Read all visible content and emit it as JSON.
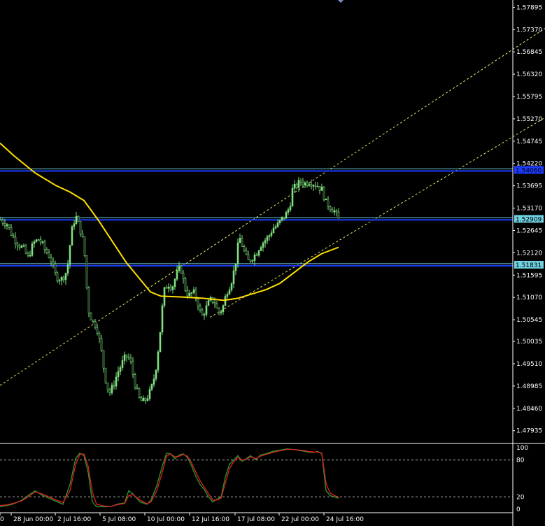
{
  "colors": {
    "background": "#000000",
    "axis": "#ffffff",
    "bull_candle": "#7fe07f",
    "bear_candle": "#7fe07f",
    "ma_line": "#ffe000",
    "channel": "#e8e86a",
    "hline_blue": "#1e3cff",
    "hline_cyan": "#6fd0e0",
    "stoch_main": "#2e9a2e",
    "stoch_signal": "#e02020",
    "stoch_level": "#bbbbbb"
  },
  "chart_data": [
    {
      "type": "candlestick",
      "panel": "price",
      "ylim": [
        1.477,
        1.58
      ],
      "y_ticks": [
        "1.57895",
        "1.57370",
        "1.56845",
        "1.56320",
        "1.55795",
        "1.55270",
        "1.54745",
        "1.54220",
        "1.53695",
        "1.53170",
        "1.52645",
        "1.52120",
        "1.51595",
        "1.51070",
        "1.50545",
        "1.50035",
        "1.49510",
        "1.48985",
        "1.48460",
        "1.47935"
      ],
      "x_ticks": [
        "0",
        "28 Jun 00:00",
        "2 Jul 16:00",
        "5 Jul 08:00",
        "10 Jul 00:00",
        "12 Jul 16:00",
        "17 Jul 08:00",
        "22 Jul 00:00",
        "24 Jul 16:00"
      ],
      "close_path": [
        [
          0,
          1.529
        ],
        [
          10,
          1.528
        ],
        [
          18,
          1.525
        ],
        [
          25,
          1.5235
        ],
        [
          34,
          1.522
        ],
        [
          40,
          1.52
        ],
        [
          48,
          1.5235
        ],
        [
          56,
          1.5245
        ],
        [
          64,
          1.522
        ],
        [
          72,
          1.52
        ],
        [
          80,
          1.5155
        ],
        [
          88,
          1.515
        ],
        [
          96,
          1.517
        ],
        [
          102,
          1.526
        ],
        [
          108,
          1.53
        ],
        [
          114,
          1.527
        ],
        [
          120,
          1.523
        ],
        [
          126,
          1.508
        ],
        [
          132,
          1.505
        ],
        [
          138,
          1.504
        ],
        [
          144,
          1.499
        ],
        [
          150,
          1.492
        ],
        [
          156,
          1.488
        ],
        [
          162,
          1.49
        ],
        [
          168,
          1.493
        ],
        [
          174,
          1.495
        ],
        [
          180,
          1.497
        ],
        [
          186,
          1.496
        ],
        [
          192,
          1.491
        ],
        [
          198,
          1.487
        ],
        [
          204,
          1.486
        ],
        [
          210,
          1.487
        ],
        [
          216,
          1.489
        ],
        [
          222,
          1.493
        ],
        [
          228,
          1.501
        ],
        [
          234,
          1.512
        ],
        [
          240,
          1.514
        ],
        [
          246,
          1.513
        ],
        [
          252,
          1.516
        ],
        [
          258,
          1.518
        ],
        [
          264,
          1.513
        ],
        [
          270,
          1.511
        ],
        [
          276,
          1.512
        ],
        [
          282,
          1.51
        ],
        [
          288,
          1.506
        ],
        [
          294,
          1.508
        ],
        [
          300,
          1.51
        ],
        [
          306,
          1.51
        ],
        [
          312,
          1.507
        ],
        [
          318,
          1.508
        ],
        [
          324,
          1.512
        ],
        [
          330,
          1.514
        ],
        [
          336,
          1.518
        ],
        [
          342,
          1.525
        ],
        [
          348,
          1.522
        ],
        [
          354,
          1.519
        ],
        [
          360,
          1.52
        ],
        [
          366,
          1.521
        ],
        [
          372,
          1.523
        ],
        [
          378,
          1.524
        ],
        [
          384,
          1.525
        ],
        [
          390,
          1.527
        ],
        [
          396,
          1.5275
        ],
        [
          402,
          1.529
        ],
        [
          408,
          1.53
        ],
        [
          414,
          1.532
        ],
        [
          418,
          1.536
        ],
        [
          424,
          1.537
        ],
        [
          430,
          1.538
        ],
        [
          436,
          1.5375
        ],
        [
          442,
          1.538
        ],
        [
          448,
          1.5375
        ],
        [
          454,
          1.537
        ],
        [
          460,
          1.536
        ],
        [
          466,
          1.533
        ],
        [
          472,
          1.532
        ],
        [
          478,
          1.531
        ],
        [
          484,
          1.529
        ]
      ],
      "moving_average": [
        [
          0,
          1.547
        ],
        [
          20,
          1.544
        ],
        [
          50,
          1.54
        ],
        [
          80,
          1.537
        ],
        [
          100,
          1.5355
        ],
        [
          120,
          1.5335
        ],
        [
          140,
          1.529
        ],
        [
          160,
          1.524
        ],
        [
          180,
          1.519
        ],
        [
          200,
          1.515
        ],
        [
          215,
          1.512
        ],
        [
          230,
          1.511
        ],
        [
          260,
          1.5108
        ],
        [
          290,
          1.5105
        ],
        [
          320,
          1.51
        ],
        [
          340,
          1.5105
        ],
        [
          360,
          1.5115
        ],
        [
          380,
          1.5125
        ],
        [
          400,
          1.514
        ],
        [
          420,
          1.5165
        ],
        [
          440,
          1.519
        ],
        [
          460,
          1.521
        ],
        [
          484,
          1.5225
        ]
      ],
      "horizontal_lines": [
        {
          "price": 1.5406,
          "label": "1.54060"
        },
        {
          "price": 1.52909,
          "label": "1.52909"
        },
        {
          "price": 1.51831,
          "label": "1.51831"
        }
      ],
      "channel_lines": [
        {
          "from": [
            0,
            1.49
          ],
          "to": [
            779,
            1.574
          ]
        },
        {
          "from": [
            300,
            1.506
          ],
          "to": [
            779,
            1.553
          ]
        }
      ]
    },
    {
      "type": "line",
      "panel": "stochastic",
      "ylim": [
        0,
        100
      ],
      "y_ticks": [
        "100",
        "80",
        "20",
        "0"
      ],
      "levels": [
        80,
        20
      ],
      "series": [
        {
          "key": "main",
          "values": [
            [
              0,
              4
            ],
            [
              10,
              6
            ],
            [
              20,
              9
            ],
            [
              30,
              14
            ],
            [
              40,
              22
            ],
            [
              50,
              30
            ],
            [
              60,
              23
            ],
            [
              70,
              18
            ],
            [
              80,
              13
            ],
            [
              90,
              8
            ],
            [
              100,
              40
            ],
            [
              108,
              82
            ],
            [
              114,
              91
            ],
            [
              120,
              87
            ],
            [
              126,
              60
            ],
            [
              132,
              12
            ],
            [
              138,
              4
            ],
            [
              150,
              4
            ],
            [
              160,
              5
            ],
            [
              170,
              9
            ],
            [
              178,
              10
            ],
            [
              184,
              30
            ],
            [
              190,
              25
            ],
            [
              200,
              12
            ],
            [
              210,
              8
            ],
            [
              216,
              15
            ],
            [
              224,
              38
            ],
            [
              232,
              70
            ],
            [
              238,
              91
            ],
            [
              244,
              90
            ],
            [
              250,
              82
            ],
            [
              256,
              88
            ],
            [
              262,
              90
            ],
            [
              268,
              84
            ],
            [
              274,
              70
            ],
            [
              280,
              53
            ],
            [
              286,
              40
            ],
            [
              292,
              32
            ],
            [
              298,
              20
            ],
            [
              304,
              12
            ],
            [
              310,
              16
            ],
            [
              316,
              20
            ],
            [
              322,
              52
            ],
            [
              328,
              73
            ],
            [
              334,
              80
            ],
            [
              340,
              87
            ],
            [
              346,
              78
            ],
            [
              352,
              82
            ],
            [
              358,
              87
            ],
            [
              366,
              80
            ],
            [
              372,
              88
            ],
            [
              380,
              90
            ],
            [
              390,
              94
            ],
            [
              400,
              96
            ],
            [
              410,
              98
            ],
            [
              420,
              97
            ],
            [
              430,
              95
            ],
            [
              440,
              93
            ],
            [
              448,
              92
            ],
            [
              454,
              94
            ],
            [
              460,
              90
            ],
            [
              466,
              30
            ],
            [
              472,
              22
            ],
            [
              478,
              20
            ],
            [
              484,
              18
            ]
          ]
        },
        {
          "key": "signal",
          "values": [
            [
              0,
              6
            ],
            [
              10,
              7
            ],
            [
              20,
              10
            ],
            [
              30,
              13
            ],
            [
              40,
              20
            ],
            [
              50,
              28
            ],
            [
              60,
              25
            ],
            [
              70,
              20
            ],
            [
              80,
              15
            ],
            [
              90,
              11
            ],
            [
              100,
              30
            ],
            [
              108,
              72
            ],
            [
              114,
              89
            ],
            [
              120,
              90
            ],
            [
              126,
              70
            ],
            [
              132,
              28
            ],
            [
              138,
              8
            ],
            [
              150,
              5
            ],
            [
              160,
              5
            ],
            [
              170,
              8
            ],
            [
              178,
              9
            ],
            [
              184,
              22
            ],
            [
              190,
              24
            ],
            [
              200,
              15
            ],
            [
              210,
              9
            ],
            [
              216,
              12
            ],
            [
              224,
              30
            ],
            [
              232,
              60
            ],
            [
              238,
              86
            ],
            [
              244,
              90
            ],
            [
              250,
              85
            ],
            [
              256,
              86
            ],
            [
              262,
              89
            ],
            [
              268,
              86
            ],
            [
              274,
              75
            ],
            [
              280,
              60
            ],
            [
              286,
              46
            ],
            [
              292,
              36
            ],
            [
              298,
              25
            ],
            [
              304,
              15
            ],
            [
              310,
              15
            ],
            [
              316,
              18
            ],
            [
              322,
              42
            ],
            [
              328,
              66
            ],
            [
              334,
              77
            ],
            [
              340,
              84
            ],
            [
              346,
              80
            ],
            [
              352,
              81
            ],
            [
              358,
              85
            ],
            [
              366,
              82
            ],
            [
              372,
              86
            ],
            [
              380,
              89
            ],
            [
              390,
              92
            ],
            [
              400,
              95
            ],
            [
              410,
              97
            ],
            [
              420,
              97
            ],
            [
              430,
              96
            ],
            [
              440,
              94
            ],
            [
              448,
              93
            ],
            [
              454,
              93
            ],
            [
              460,
              91
            ],
            [
              466,
              42
            ],
            [
              472,
              26
            ],
            [
              478,
              22
            ],
            [
              484,
              20
            ]
          ]
        }
      ]
    }
  ]
}
